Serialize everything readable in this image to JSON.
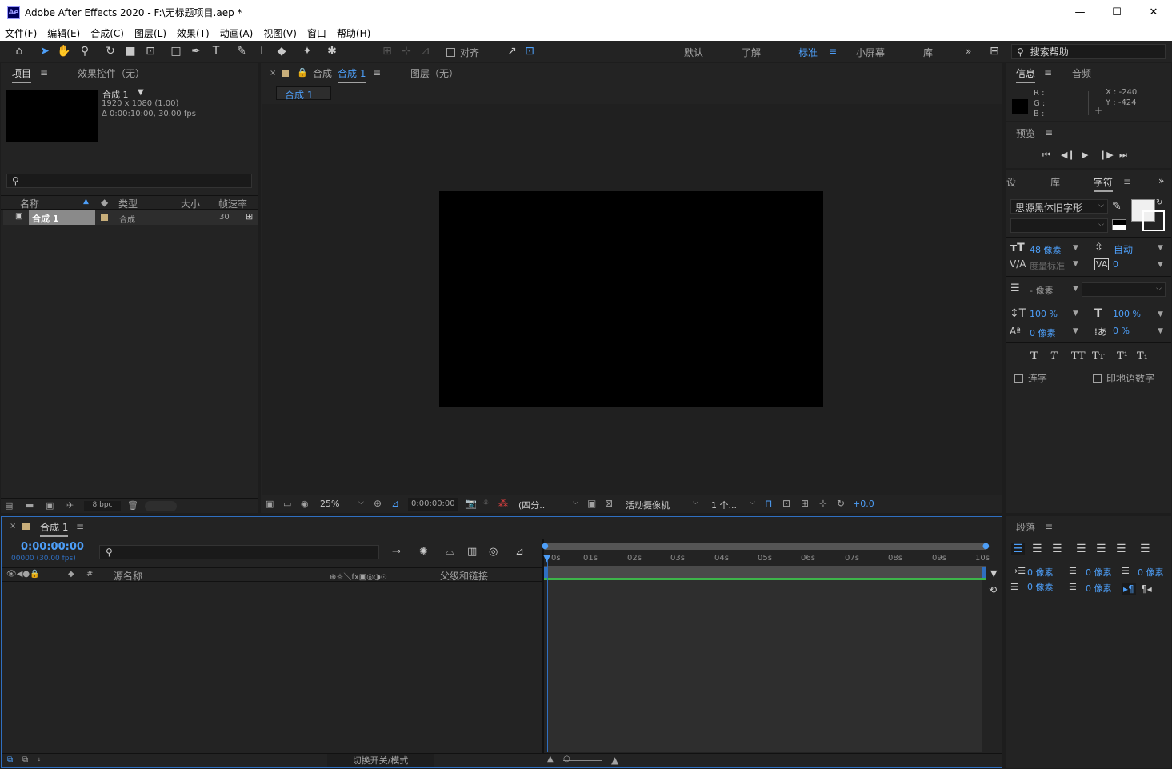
{
  "window": {
    "title": "Adobe After Effects 2020 - F:\\无标题项目.aep *",
    "logo": "Ae",
    "minimize": "—",
    "maximize": "☐",
    "close": "✕"
  },
  "menu": [
    "文件(F)",
    "编辑(E)",
    "合成(C)",
    "图层(L)",
    "效果(T)",
    "动画(A)",
    "视图(V)",
    "窗口",
    "帮助(H)"
  ],
  "toolbar": {
    "align_label": "对齐",
    "workspaces": [
      "默认",
      "了解",
      "标准",
      "小屏幕",
      "库"
    ],
    "active_workspace": "标准",
    "more": "»",
    "search_help": "搜索帮助"
  },
  "project_panel": {
    "tab_project": "项目",
    "tab_effects": "效果控件（无）",
    "comp_name": "合成 1",
    "comp_size": "1920 x 1080 (1.00)",
    "comp_duration": "Δ 0:00:10:00, 30.00 fps",
    "columns": [
      "名称",
      "类型",
      "大小",
      "帧速率"
    ],
    "rows": [
      {
        "name": "合成 1",
        "type": "合成",
        "size": "",
        "fps": "30"
      }
    ],
    "bpc": "8 bpc"
  },
  "comp_panel": {
    "tab_prefix": "合成",
    "tab_name": "合成 1",
    "layer_tab": "图层（无）",
    "sub_tab": "合成 1",
    "zoom": "25%",
    "timecode": "0:00:00:00",
    "resolution": "(四分..",
    "camera": "活动摄像机",
    "views": "1 个...",
    "exposure": "+0.0"
  },
  "info_panel": {
    "tab_info": "信息",
    "tab_audio": "音频",
    "r_label": "R :",
    "g_label": "G :",
    "b_label": "B :",
    "x_label": "X : -240",
    "y_label": "Y : -424"
  },
  "preview_panel": {
    "title": "预览"
  },
  "character_panel": {
    "tab_settings": "设",
    "tab_library": "库",
    "tab_character": "字符",
    "font": "思源黑体旧字形",
    "style": "-",
    "font_size": "48 像素",
    "leading": "自动",
    "kerning": "度量标准",
    "tracking": "0",
    "stroke": "- 像素",
    "vscale": "100 %",
    "hscale": "100 %",
    "baseline": "0 像素",
    "tsume": "0 %",
    "ligature": "连字",
    "hindi_digits": "印地语数字"
  },
  "paragraph_panel": {
    "title": "段落",
    "indent_left": "0 像素",
    "indent_first": "0 像素",
    "indent_right": "0 像素",
    "space_before": "0 像素",
    "space_after": "0 像素"
  },
  "timeline": {
    "tab_name": "合成 1",
    "timecode": "0:00:00:00",
    "frames": "00000 (30.00 fps)",
    "source_name": "源名称",
    "parent_link": "父级和链接",
    "toggle_modes": "切换开关/模式",
    "ruler": [
      "0s",
      "01s",
      "02s",
      "03s",
      "04s",
      "05s",
      "06s",
      "07s",
      "08s",
      "09s",
      "10s"
    ]
  },
  "colors": {
    "accent": "#4d9ef7",
    "panel": "#232323",
    "bg": "#1d1d1d",
    "work_area": "#3db54a"
  }
}
